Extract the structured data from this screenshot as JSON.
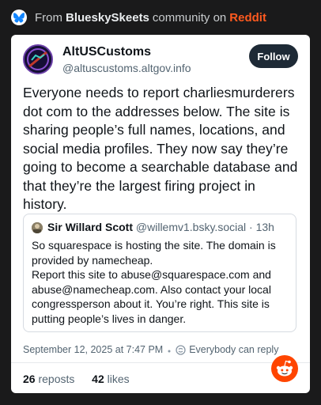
{
  "header": {
    "prefix": "From",
    "community": "BlueskySkeets",
    "middle": "community on",
    "platform": "Reddit"
  },
  "post": {
    "author_name": "AltUSCustoms",
    "author_handle": "@altuscustoms.altgov.info",
    "follow_label": "Follow",
    "text": "Everyone needs to report charliesmurderers dot com to the addresses below. The site is sharing people’s full names, locations, and social media profiles. They now say they’re going to become a searchable database and that they’re the largest firing project in history.",
    "timestamp": "September 12, 2025 at 7:47 PM",
    "reply_setting": "Everybody can reply",
    "reposts_count": "26",
    "reposts_label": "reposts",
    "likes_count": "42",
    "likes_label": "likes"
  },
  "quote": {
    "author_name": "Sir Willard Scott",
    "author_handle": "@willemv1.bsky.social",
    "separator": "·",
    "age": "13h",
    "text": "So squarespace is hosting the site. The domain is provided by namecheap.\nReport this site to abuse@squarespace.com and abuse@namecheap.com. Also contact your local congressperson about it. You’re right. This site is putting people’s lives in danger."
  },
  "colors": {
    "page_bg": "#1a1a1b",
    "reddit_accent": "#ff5a1f",
    "bluesky_blue": "#1185fe",
    "follow_bg": "#1e2a36",
    "muted_text": "#536471"
  },
  "icons": {
    "bluesky": "butterfly-icon",
    "avatar": "altuscustoms-avatar",
    "reply": "reply-setting-icon",
    "reddit": "reddit-snoo-icon"
  }
}
